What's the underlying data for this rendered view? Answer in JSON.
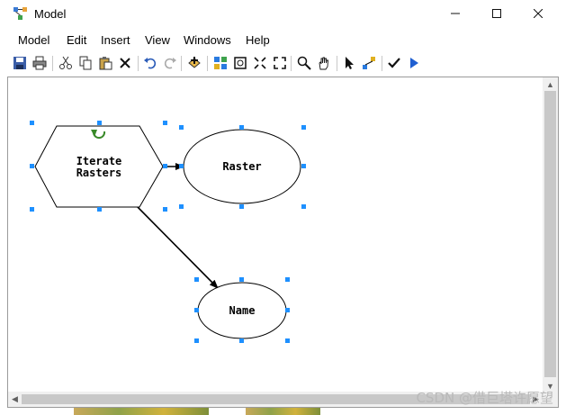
{
  "window": {
    "title": "Model"
  },
  "menubar": {
    "items": [
      "Model",
      "Edit",
      "Insert",
      "View",
      "Windows",
      "Help"
    ]
  },
  "toolbar": {
    "icons": [
      "save-icon",
      "print-icon",
      "cut-icon",
      "copy-icon",
      "paste-icon",
      "delete-icon",
      "undo-icon",
      "redo-icon",
      "add-data-icon",
      "auto-layout-icon",
      "full-extent-icon",
      "zoom-in-fixed-icon",
      "zoom-out-fixed-icon",
      "zoom-icon",
      "pan-icon",
      "select-icon",
      "connect-icon",
      "validate-icon",
      "run-icon"
    ]
  },
  "diagram": {
    "nodes": [
      {
        "id": "iterate",
        "shape": "hexagon",
        "label_line1": "Iterate",
        "label_line2": "Rasters"
      },
      {
        "id": "raster",
        "shape": "ellipse",
        "label": "Raster"
      },
      {
        "id": "name",
        "shape": "ellipse",
        "label": "Name"
      }
    ],
    "edges": [
      {
        "from": "iterate",
        "to": "raster"
      },
      {
        "from": "iterate",
        "to": "name"
      }
    ],
    "handle_color": "#1e90ff"
  },
  "watermark": "CSDN @借巨塔许愿望"
}
